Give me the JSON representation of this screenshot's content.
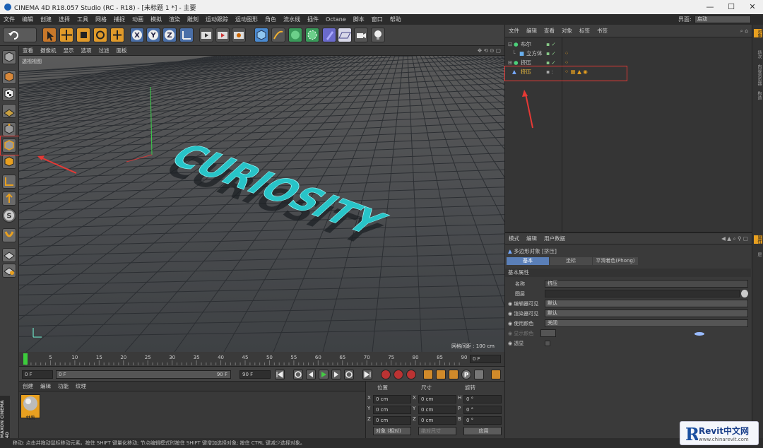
{
  "window": {
    "title": "CINEMA 4D R18.057 Studio (RC - R18) - [未标题 1 *] - 主要",
    "minimize": "—",
    "maximize": "☐",
    "close": "✕"
  },
  "menu": [
    "文件",
    "编辑",
    "创建",
    "选择",
    "工具",
    "网格",
    "捕捉",
    "动画",
    "模拟",
    "渲染",
    "雕刻",
    "运动跟踪",
    "运动图形",
    "角色",
    "流水线",
    "插件",
    "Octane",
    "脚本",
    "窗口",
    "帮助"
  ],
  "layout": {
    "label": "界面:",
    "value": "启动"
  },
  "viewport": {
    "menu": [
      "查看",
      "摄像机",
      "显示",
      "选项",
      "过滤",
      "面板"
    ],
    "label": "透视视图",
    "grid_readout": "网格间距 : 100 cm",
    "text_3d": "CURIOSITY",
    "text_color": "#28c4c8"
  },
  "timeline": {
    "ticks": [
      "0",
      "5",
      "10",
      "15",
      "20",
      "25",
      "30",
      "35",
      "40",
      "45",
      "50",
      "55",
      "60",
      "65",
      "70",
      "75",
      "80",
      "85",
      "90"
    ],
    "frame_field": "0 F"
  },
  "transport": {
    "start": "0 F",
    "range_start": "0 F",
    "range_end": "90 F",
    "end": "90 F"
  },
  "material_manager": {
    "menu": [
      "创建",
      "编辑",
      "功能",
      "纹理"
    ],
    "material_name": "材质"
  },
  "coordinates": {
    "headers": [
      "位置",
      "尺寸",
      "旋转"
    ],
    "rows": [
      {
        "axis": "X",
        "pos": "0 cm",
        "size_axis": "X",
        "size": "0 cm",
        "rot_axis": "H",
        "rot": "0 °"
      },
      {
        "axis": "Y",
        "pos": "0 cm",
        "size_axis": "Y",
        "size": "0 cm",
        "rot_axis": "P",
        "rot": "0 °"
      },
      {
        "axis": "Z",
        "pos": "0 cm",
        "size_axis": "Z",
        "size": "0 cm",
        "rot_axis": "B",
        "rot": "0 °"
      }
    ],
    "mode": "对象 (相对)",
    "size_mode": "绝对尺寸",
    "apply": "应用"
  },
  "object_manager": {
    "menu": [
      "文件",
      "编辑",
      "查看",
      "对象",
      "标签",
      "书签"
    ],
    "objects": [
      {
        "name": "布尔",
        "level": 0
      },
      {
        "name": "立方体",
        "level": 1
      },
      {
        "name": "挤压",
        "level": 1
      },
      {
        "name": "挤压",
        "level": 0,
        "selected": true
      }
    ]
  },
  "attributes": {
    "menu": [
      "模式",
      "编辑",
      "用户数据"
    ],
    "object_title": "多边形对象 [挤压]",
    "tabs": [
      "基本",
      "坐标",
      "平滑着色(Phong)"
    ],
    "section": "基本属性",
    "fields": [
      {
        "label": "名称",
        "value": "挤压"
      },
      {
        "label": "图层",
        "value": ""
      },
      {
        "label": "编辑器可见",
        "value": "默认"
      },
      {
        "label": "渲染器可见",
        "value": "默认"
      },
      {
        "label": "使用颜色",
        "value": "关闭"
      },
      {
        "label": "显示颜色",
        "value": ""
      },
      {
        "label": "透显",
        "value": ""
      }
    ]
  },
  "right_tabs": [
    "对象",
    "场次",
    "内容浏览器",
    "构造",
    "属性",
    "层"
  ],
  "maxon_label": "MAXON CINEMA 4D",
  "status": "移动: 点击并拖动鼠标移动元素。按住 SHIFT 键量化移动; 节点编辑模式时按住 SHIFT 键增加选择对象; 按住 CTRL 键减少选择对象。",
  "watermark": {
    "brand": "Revit中文网",
    "url": "www.chinarevit.com"
  },
  "colors": {
    "accent": "#e8a020",
    "annotation": "#e53935",
    "selection": "#f0c040"
  }
}
